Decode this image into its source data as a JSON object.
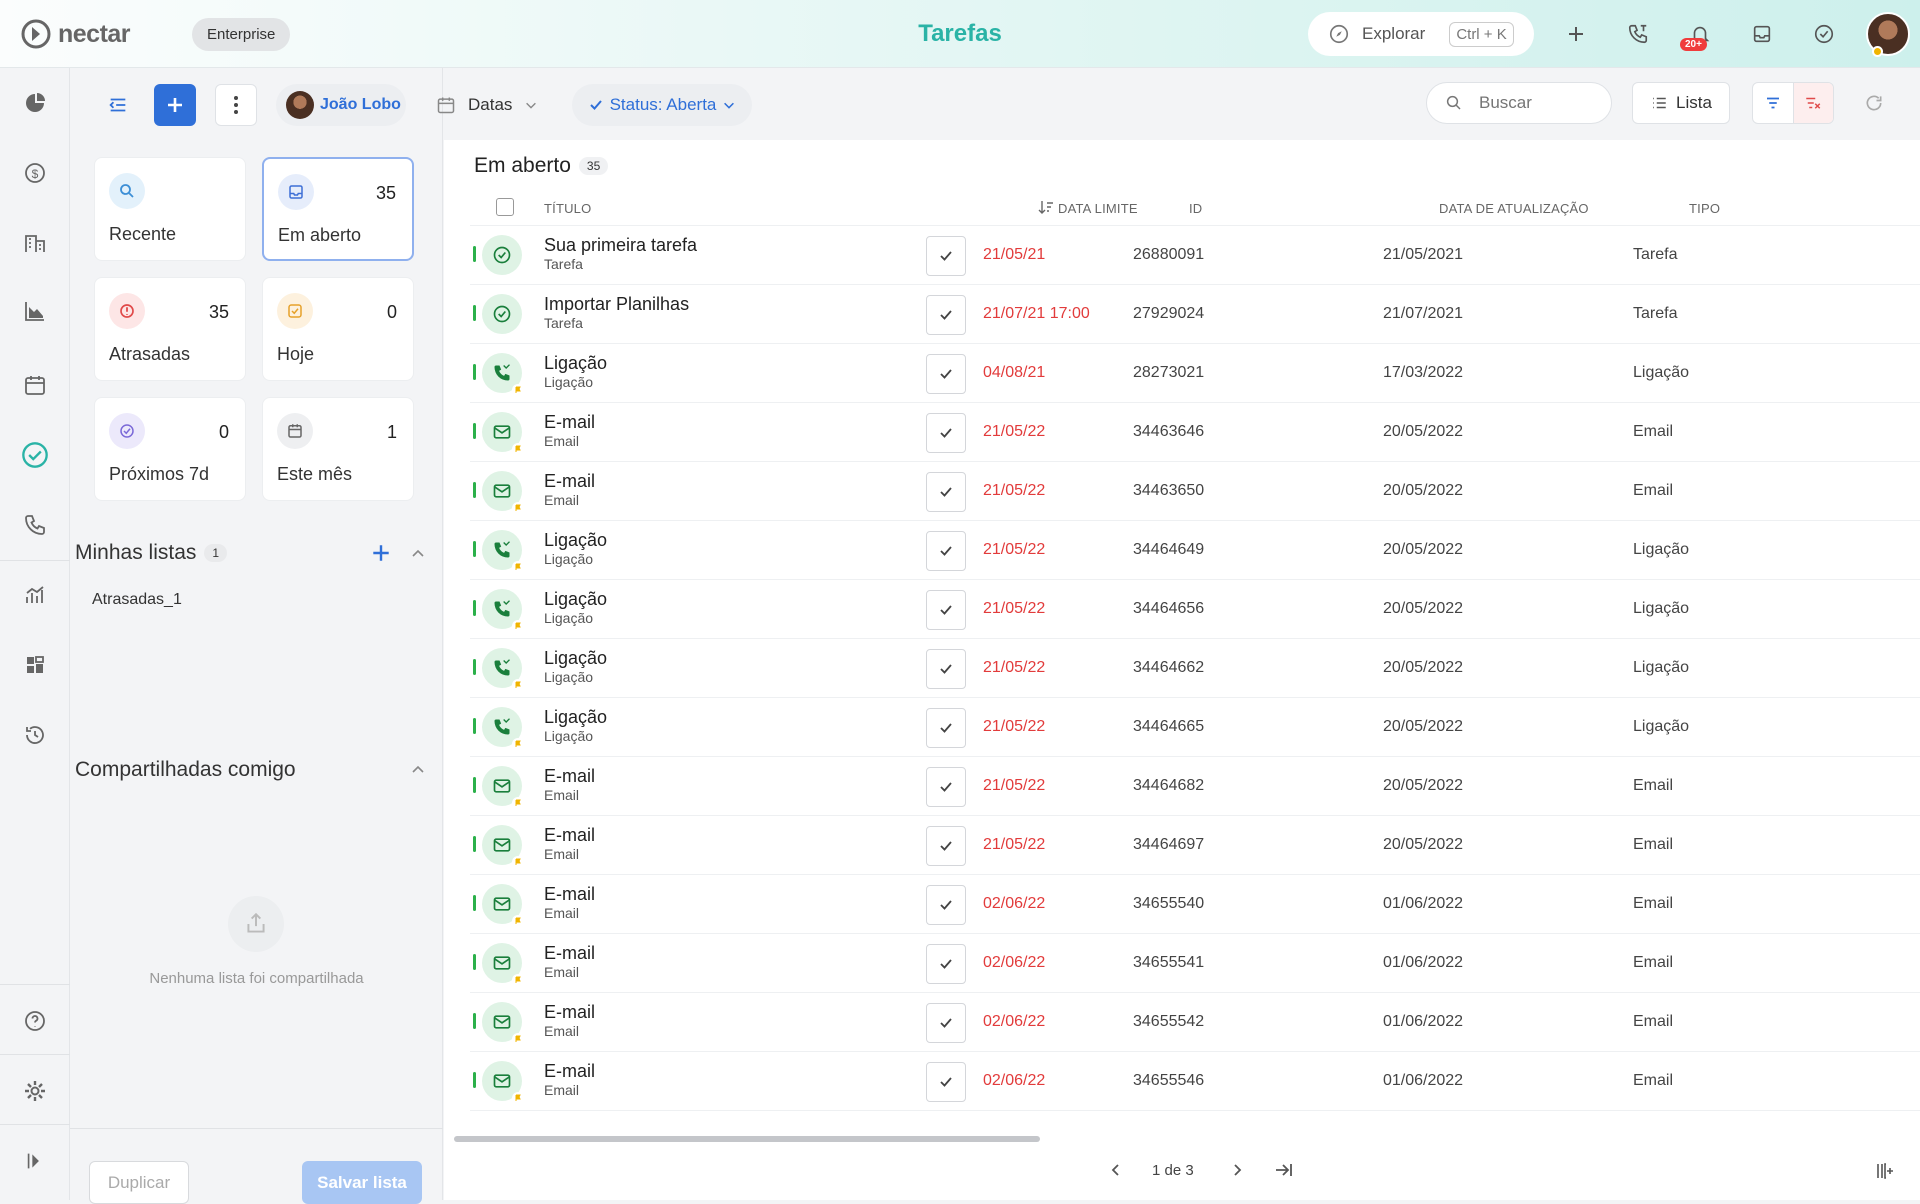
{
  "app": {
    "brand": "nectar",
    "plan": "Enterprise",
    "title": "Tarefas"
  },
  "topbar": {
    "explore_label": "Explorar",
    "explore_shortcut": "Ctrl + K",
    "notif_badge": "20+"
  },
  "rail": {
    "items": [
      "dashboard-icon",
      "dollar-icon",
      "building-icon",
      "chart-icon",
      "calendar-icon",
      "tasks-icon",
      "phone-icon",
      "analytics-icon",
      "apps-icon",
      "history-icon"
    ],
    "bottom": [
      "help-icon",
      "gear-icon",
      "expand-icon"
    ]
  },
  "toolbar": {
    "user": "João Lobo",
    "dates_label": "Datas",
    "status_filter": "Status: Aberta",
    "search_placeholder": "Buscar",
    "view_label": "Lista"
  },
  "tiles": [
    {
      "label": "Recente",
      "count": "",
      "color": "#4a9bd8"
    },
    {
      "label": "Em aberto",
      "count": "35",
      "color": "#4a7fd8"
    },
    {
      "label": "Atrasadas",
      "count": "35",
      "color": "#e04a4a"
    },
    {
      "label": "Hoje",
      "count": "0",
      "color": "#e6a12a"
    },
    {
      "label": "Próximos 7d",
      "count": "0",
      "color": "#7b6ad8"
    },
    {
      "label": "Este mês",
      "count": "1",
      "color": "#666666"
    }
  ],
  "my_lists": {
    "title": "Minhas listas",
    "count": "1",
    "items": [
      "Atrasadas_1"
    ]
  },
  "shared": {
    "title": "Compartilhadas comigo",
    "empty_text": "Nenhuma lista foi compartilhada"
  },
  "footer_buttons": {
    "duplicate": "Duplicar",
    "save": "Salvar lista"
  },
  "table": {
    "group_title": "Em aberto",
    "group_count": "35",
    "headers": {
      "title": "TÍTULO",
      "due": "DATA LIMITE",
      "id": "ID",
      "updated": "DATA DE ATUALIZAÇÃO",
      "type": "TIPO"
    },
    "rows": [
      {
        "icon": "task",
        "title": "Sua primeira tarefa",
        "subtitle": "Tarefa",
        "due": "21/05/21",
        "id": "26880091",
        "updated": "21/05/2021",
        "type": "Tarefa"
      },
      {
        "icon": "task",
        "title": "Importar Planilhas",
        "subtitle": "Tarefa",
        "due": "21/07/21 17:00",
        "id": "27929024",
        "updated": "21/07/2021",
        "type": "Tarefa"
      },
      {
        "icon": "phone",
        "title": "Ligação",
        "subtitle": "Ligação",
        "due": "04/08/21",
        "id": "28273021",
        "updated": "17/03/2022",
        "type": "Ligação"
      },
      {
        "icon": "mail",
        "title": "E-mail",
        "subtitle": "Email",
        "due": "21/05/22",
        "id": "34463646",
        "updated": "20/05/2022",
        "type": "Email"
      },
      {
        "icon": "mail",
        "title": "E-mail",
        "subtitle": "Email",
        "due": "21/05/22",
        "id": "34463650",
        "updated": "20/05/2022",
        "type": "Email"
      },
      {
        "icon": "phone",
        "title": "Ligação",
        "subtitle": "Ligação",
        "due": "21/05/22",
        "id": "34464649",
        "updated": "20/05/2022",
        "type": "Ligação"
      },
      {
        "icon": "phone",
        "title": "Ligação",
        "subtitle": "Ligação",
        "due": "21/05/22",
        "id": "34464656",
        "updated": "20/05/2022",
        "type": "Ligação"
      },
      {
        "icon": "phone",
        "title": "Ligação",
        "subtitle": "Ligação",
        "due": "21/05/22",
        "id": "34464662",
        "updated": "20/05/2022",
        "type": "Ligação"
      },
      {
        "icon": "phone",
        "title": "Ligação",
        "subtitle": "Ligação",
        "due": "21/05/22",
        "id": "34464665",
        "updated": "20/05/2022",
        "type": "Ligação"
      },
      {
        "icon": "mail",
        "title": "E-mail",
        "subtitle": "Email",
        "due": "21/05/22",
        "id": "34464682",
        "updated": "20/05/2022",
        "type": "Email"
      },
      {
        "icon": "mail",
        "title": "E-mail",
        "subtitle": "Email",
        "due": "21/05/22",
        "id": "34464697",
        "updated": "20/05/2022",
        "type": "Email"
      },
      {
        "icon": "mail",
        "title": "E-mail",
        "subtitle": "Email",
        "due": "02/06/22",
        "id": "34655540",
        "updated": "01/06/2022",
        "type": "Email"
      },
      {
        "icon": "mail",
        "title": "E-mail",
        "subtitle": "Email",
        "due": "02/06/22",
        "id": "34655541",
        "updated": "01/06/2022",
        "type": "Email"
      },
      {
        "icon": "mail",
        "title": "E-mail",
        "subtitle": "Email",
        "due": "02/06/22",
        "id": "34655542",
        "updated": "01/06/2022",
        "type": "Email"
      },
      {
        "icon": "mail",
        "title": "E-mail",
        "subtitle": "Email",
        "due": "02/06/22",
        "id": "34655546",
        "updated": "01/06/2022",
        "type": "Email"
      }
    ]
  },
  "pagination": {
    "label": "1 de 3"
  }
}
